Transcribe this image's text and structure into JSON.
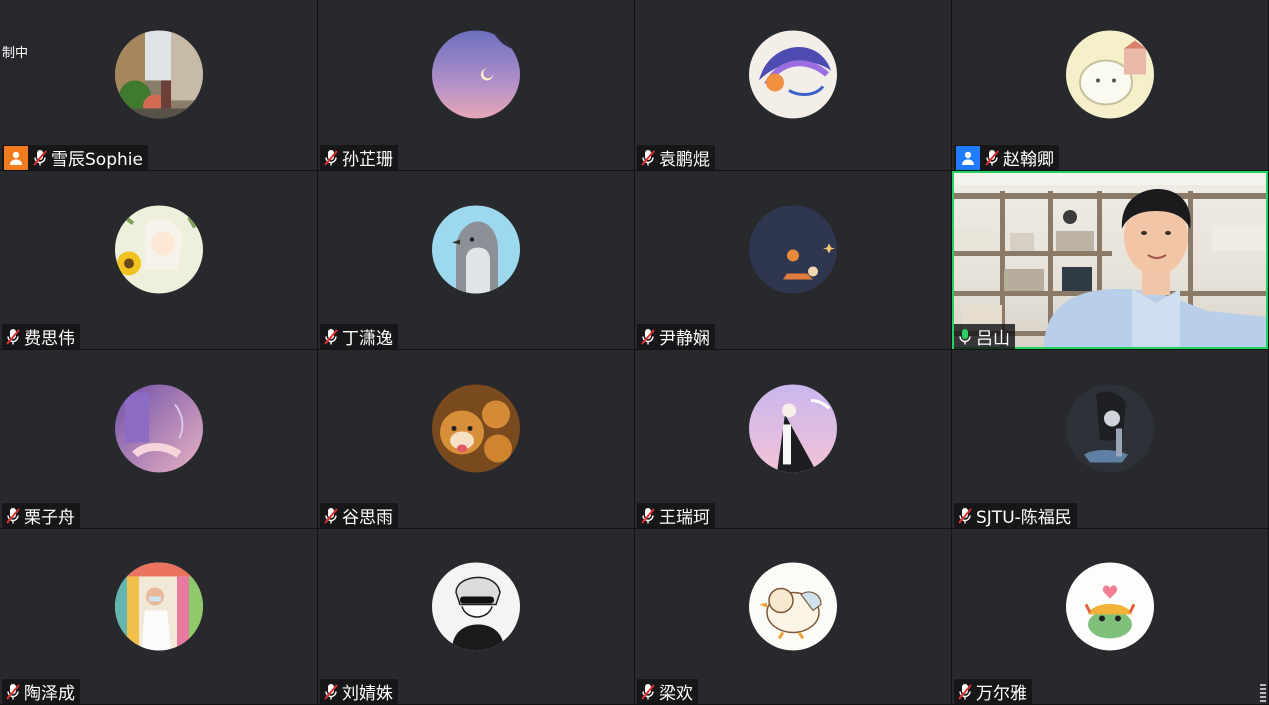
{
  "meeting": {
    "recording_label": "制中",
    "active_speaker_color": "#23d35f",
    "host_badge_color": "#f47a1f",
    "cohost_badge_color": "#1f7bff",
    "participants": [
      {
        "name": "雪辰Sophie",
        "mic": "muted",
        "badge": "host",
        "avatar": "street-photo"
      },
      {
        "name": "孙芷珊",
        "mic": "muted",
        "avatar": "purple-moon-sky"
      },
      {
        "name": "袁鹏焜",
        "mic": "muted",
        "avatar": "watercolor-hair-art"
      },
      {
        "name": "赵翰卿",
        "mic": "muted",
        "badge": "cohost",
        "avatar": "cartoon-cat"
      },
      {
        "name": "费思伟",
        "mic": "muted",
        "avatar": "sunflower-anime"
      },
      {
        "name": "丁潇逸",
        "mic": "muted",
        "avatar": "penguin"
      },
      {
        "name": "尹静娴",
        "mic": "muted",
        "avatar": "space-planets"
      },
      {
        "name": "吕山",
        "mic": "active",
        "avatar": "live-video"
      },
      {
        "name": "栗子舟",
        "mic": "muted",
        "avatar": "purple-room-art"
      },
      {
        "name": "谷思雨",
        "mic": "muted",
        "avatar": "shiba-dogs"
      },
      {
        "name": "王瑞珂",
        "mic": "muted",
        "avatar": "anime-cape-figure"
      },
      {
        "name": "SJTU-陈福民",
        "mic": "muted",
        "avatar": "dark-anime"
      },
      {
        "name": "陶泽成",
        "mic": "muted",
        "avatar": "person-photo"
      },
      {
        "name": "刘婧姝",
        "mic": "muted",
        "avatar": "manga-sketch"
      },
      {
        "name": "梁欢",
        "mic": "muted",
        "avatar": "sleeping-duck"
      },
      {
        "name": "万尔雅",
        "mic": "muted",
        "avatar": "frog-lion-cartoon"
      }
    ]
  }
}
